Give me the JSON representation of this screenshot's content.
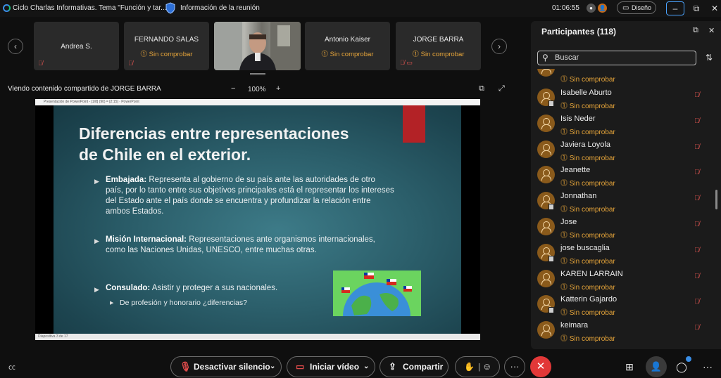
{
  "titlebar": {
    "meeting_title": "Ciclo Charlas Informativas. Tema \"Función y tar...",
    "meeting_info": "Información de la reunión",
    "timer": "01:06:55",
    "design_label": "Diseño",
    "minimize": "–",
    "restore": "⧉",
    "close": "✕"
  },
  "tiles": [
    {
      "name": "Andrea S.",
      "status": ""
    },
    {
      "name": "FERNANDO SALAS",
      "status": "Sin comprobar"
    },
    {
      "name": "Antonio Kaiser",
      "status": "Sin comprobar"
    },
    {
      "name": "JORGE BARRA",
      "status": "Sin comprobar"
    }
  ],
  "share": {
    "title": "Viendo contenido compartido de JORGE BARRA",
    "zoom_out": "−",
    "zoom_level": "100%",
    "zoom_in": "+"
  },
  "slide": {
    "window_title": "Presentación de PowerPoint - [1/8] (90) = [2:15] · PowerPoint",
    "footer": "Diapositiva 3 de 17",
    "title_line1": "Diferencias entre representaciones",
    "title_line2": "de Chile en el exterior.",
    "bullets": [
      {
        "head": "Embajada:",
        "text": " Representa al gobierno de su país ante las autoridades de otro país, por lo tanto entre sus objetivos principales está el representar los intereses del Estado ante el país donde se encuentra y profundizar la relación entre ambos Estados."
      },
      {
        "head": "Misión Internacional:",
        "text": " Representaciones ante organismos internacionales, como las Naciones Unidas, UNESCO, entre muchas otras."
      },
      {
        "head": "Consulado:",
        "text": " Asistir y proteger a sus nacionales."
      }
    ],
    "sub_bullet": "De profesión y honorario ¿diferencias?"
  },
  "participants": {
    "title": "Participantes (118)",
    "search_placeholder": "Buscar",
    "top_partial_status": "Sin comprobar",
    "list": [
      {
        "name": "Isabelle Aburto",
        "status": "Sin comprobar"
      },
      {
        "name": "Isis Neder",
        "status": "Sin comprobar"
      },
      {
        "name": "Javiera Loyola",
        "status": "Sin comprobar"
      },
      {
        "name": "Jeanette",
        "status": "Sin comprobar"
      },
      {
        "name": "Jonnathan",
        "status": "Sin comprobar"
      },
      {
        "name": "Jose",
        "status": "Sin comprobar"
      },
      {
        "name": "jose buscaglia",
        "status": "Sin comprobar"
      },
      {
        "name": "KAREN LARRAIN",
        "status": "Sin comprobar"
      },
      {
        "name": "Katterin Gajardo",
        "status": "Sin comprobar"
      },
      {
        "name": "keimara",
        "status": "Sin comprobar"
      }
    ]
  },
  "controls": {
    "mute": "Desactivar silencio",
    "video": "Iniciar vídeo",
    "share": "Compartir"
  },
  "colors": {
    "warning": "#e8a63a",
    "muted_mic": "#d9534f",
    "hangup": "#e23838",
    "focus": "#4aa3ff"
  }
}
